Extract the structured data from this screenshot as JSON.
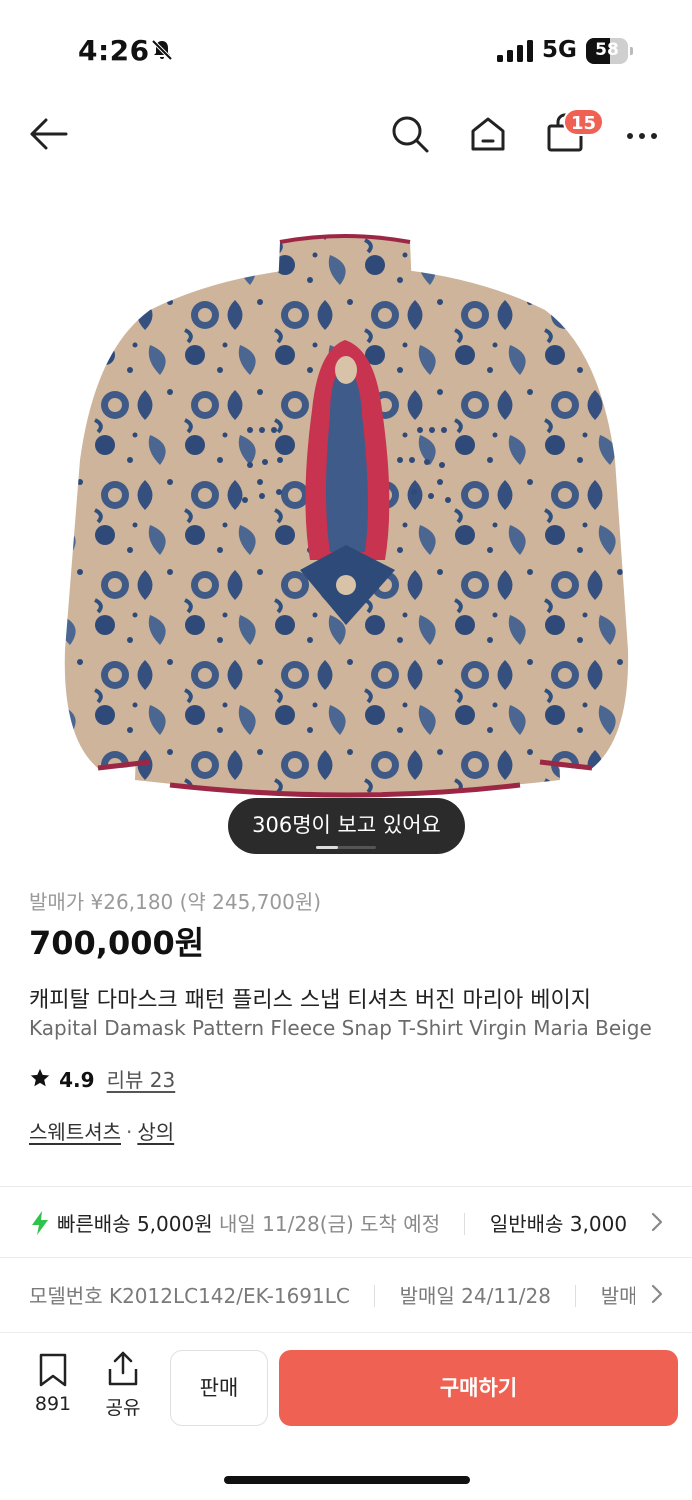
{
  "status_bar": {
    "time": "4:26",
    "network": "5G",
    "battery": "58",
    "battery_level": 0.58
  },
  "nav": {
    "cart_badge": "15"
  },
  "product": {
    "image_alt": "Kapital damask pattern fleece jacket, back view with Virgin Maria motif",
    "viewers_text": "306명이 보고 있어요",
    "release_price": "발매가 ¥26,180 (약 245,700원)",
    "price": "700,000원",
    "title_ko": "캐피탈 다마스크 패턴 플리스 스냅 티셔츠 버진 마리아 베이지",
    "title_en": "Kapital Damask Pattern Fleece Snap T-Shirt Virgin Maria Beige",
    "rating": "4.9",
    "review_label": "리뷰 23",
    "category_1": "스웨트셔츠",
    "category_sep": "·",
    "category_2": "상의"
  },
  "shipping": {
    "fast_label": "빠른배송 5,000원",
    "fast_eta": "내일 11/28(금) 도착 예정",
    "normal_label": "일반배송 3,000"
  },
  "details": {
    "model_label": "모델번호 K2012LC142/EK-1691LC",
    "release_label": "발매일 24/11/28",
    "more_label": "발매"
  },
  "bottom_bar": {
    "bookmark_count": "891",
    "share_label": "공유",
    "sell_label": "판매",
    "buy_label": "구매하기"
  },
  "colors": {
    "accent": "#ef6253",
    "bolt": "#2fc34b"
  }
}
